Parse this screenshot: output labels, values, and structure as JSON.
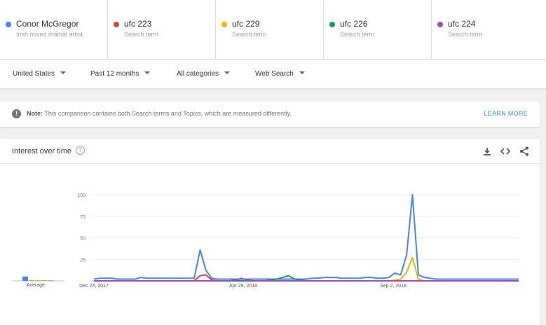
{
  "terms": [
    {
      "name": "Conor McGregor",
      "sub": "Irish mixed martial artist",
      "color": "#4285f4"
    },
    {
      "name": "ufc 223",
      "sub": "Search term",
      "color": "#db4437"
    },
    {
      "name": "ufc 229",
      "sub": "Search term",
      "color": "#f4b400"
    },
    {
      "name": "ufc 226",
      "sub": "Search term",
      "color": "#0f9d58"
    },
    {
      "name": "ufc 224",
      "sub": "Search term",
      "color": "#ab47bc"
    }
  ],
  "filters": {
    "region": "United States",
    "time": "Past 12 months",
    "category": "All categories",
    "property": "Web Search"
  },
  "note": {
    "label": "Note:",
    "text": "This comparison contains both Search terms and Topics, which are measured differently.",
    "link": "LEARN MORE",
    "icon": "info-icon"
  },
  "interest": {
    "title": "Interest over time",
    "help_icon": "help-icon",
    "tools": [
      "download-icon",
      "embed-icon",
      "share-icon"
    ],
    "average_label": "Average"
  },
  "chart_data": {
    "type": "line",
    "ylim": [
      0,
      100
    ],
    "yticks": [
      "100",
      "75",
      "50",
      "25"
    ],
    "xticks": [
      "Dec 24, 2017",
      "Apr 29, 2018",
      "Sep 2, 2018"
    ],
    "averages": [
      {
        "name": "Conor McGregor",
        "value": 5
      },
      {
        "name": "ufc 223",
        "value": 0
      },
      {
        "name": "ufc 229",
        "value": 1
      },
      {
        "name": "ufc 226",
        "value": 0
      },
      {
        "name": "ufc 224",
        "value": 0
      }
    ],
    "series": [
      {
        "name": "Conor McGregor",
        "color": "#4285f4",
        "values": [
          2,
          3,
          3,
          3,
          2,
          2,
          2,
          2,
          4,
          3,
          3,
          3,
          3,
          3,
          3,
          3,
          3,
          3,
          36,
          12,
          3,
          2,
          2,
          2,
          2,
          2,
          2,
          2,
          2,
          2,
          2,
          2,
          2,
          2,
          2,
          2,
          2,
          3,
          3,
          4,
          4,
          4,
          3,
          3,
          3,
          3,
          4,
          4,
          3,
          3,
          4,
          9,
          7,
          30,
          100,
          7,
          4,
          3,
          2,
          2,
          2,
          2,
          2,
          2,
          2,
          2,
          2,
          2,
          2,
          2,
          2,
          2,
          2
        ]
      },
      {
        "name": "ufc 223",
        "color": "#db4437",
        "values": [
          0,
          0,
          0,
          0,
          0,
          0,
          0,
          0,
          0,
          0,
          0,
          0,
          0,
          0,
          0,
          0,
          0,
          0,
          6,
          7,
          1,
          0,
          0,
          0,
          0,
          0,
          0,
          0,
          0,
          0,
          0,
          0,
          0,
          0,
          0,
          0,
          0,
          0,
          0,
          0,
          0,
          0,
          0,
          0,
          0,
          0,
          0,
          0,
          0,
          0,
          0,
          0,
          0,
          0,
          0,
          0,
          0,
          0,
          0,
          0,
          0,
          0,
          0,
          0,
          0,
          0,
          0,
          0,
          0,
          0,
          0,
          0,
          0
        ]
      },
      {
        "name": "ufc 229",
        "color": "#f4b400",
        "values": [
          0,
          0,
          0,
          0,
          0,
          0,
          0,
          0,
          0,
          0,
          0,
          0,
          0,
          0,
          0,
          0,
          0,
          0,
          0,
          0,
          0,
          0,
          0,
          0,
          0,
          0,
          0,
          0,
          0,
          0,
          0,
          0,
          0,
          0,
          0,
          0,
          0,
          0,
          0,
          0,
          0,
          0,
          0,
          0,
          0,
          0,
          0,
          0,
          0,
          0,
          0,
          1,
          2,
          10,
          27,
          2,
          0,
          0,
          0,
          0,
          0,
          0,
          0,
          0,
          0,
          0,
          0,
          0,
          0,
          0,
          0,
          0,
          0
        ]
      },
      {
        "name": "ufc 226",
        "color": "#0f9d58",
        "values": [
          0,
          0,
          0,
          0,
          0,
          0,
          0,
          0,
          0,
          0,
          0,
          0,
          0,
          0,
          0,
          0,
          0,
          0,
          0,
          0,
          0,
          0,
          0,
          0,
          0,
          0,
          0,
          0,
          0,
          0,
          1,
          2,
          4,
          6,
          2,
          1,
          0,
          0,
          0,
          0,
          0,
          0,
          0,
          0,
          0,
          0,
          0,
          0,
          0,
          0,
          0,
          0,
          0,
          0,
          0,
          0,
          0,
          0,
          0,
          0,
          0,
          0,
          0,
          0,
          0,
          0,
          0,
          0,
          0,
          0,
          0,
          0,
          0
        ]
      },
      {
        "name": "ufc 224",
        "color": "#ab47bc",
        "values": [
          0,
          0,
          0,
          0,
          0,
          0,
          0,
          0,
          0,
          0,
          0,
          0,
          0,
          0,
          0,
          0,
          0,
          0,
          0,
          0,
          0,
          0,
          0,
          0,
          1,
          3,
          1,
          0,
          0,
          0,
          0,
          0,
          0,
          0,
          0,
          0,
          0,
          0,
          0,
          0,
          0,
          0,
          0,
          0,
          0,
          0,
          0,
          0,
          0,
          0,
          0,
          0,
          0,
          0,
          0,
          0,
          0,
          0,
          0,
          0,
          0,
          0,
          0,
          0,
          0,
          0,
          0,
          0,
          0,
          0,
          0,
          0,
          0
        ]
      }
    ]
  }
}
